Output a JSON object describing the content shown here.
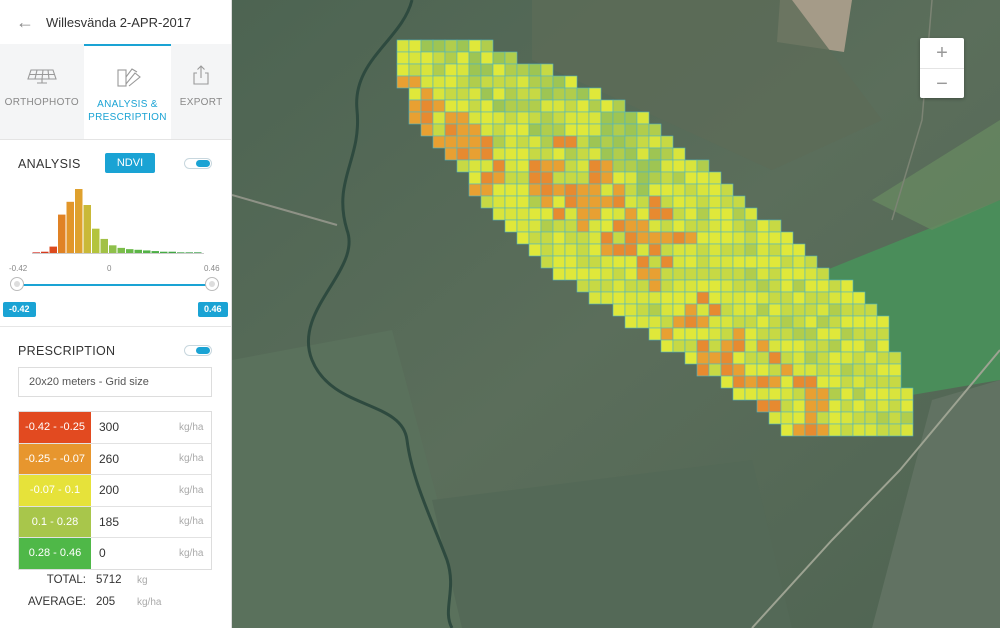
{
  "header": {
    "back_icon": "arrow-left-icon",
    "title": "Willesvända 2-APR-2017"
  },
  "tabs": [
    {
      "label": "ORTHOPHOTO",
      "icon": "solar-panel-icon",
      "active": false
    },
    {
      "label": "ANALYSIS &\nPRESCRIPTION",
      "icon": "color-swatch-icon",
      "active": true
    },
    {
      "label": "EXPORT",
      "icon": "export-icon",
      "active": false
    }
  ],
  "analysis": {
    "title": "ANALYSIS",
    "index_button": "NDVI",
    "toggle_on": true,
    "histogram": {
      "ticks": [
        "-0.42",
        "0",
        "0.46"
      ],
      "bins": [
        1,
        2,
        10,
        60,
        80,
        100,
        75,
        38,
        22,
        12,
        8,
        6,
        5,
        4,
        3,
        2,
        2,
        1,
        1,
        1
      ],
      "bin_colors": [
        "#d4281e",
        "#d63a1e",
        "#dc4a1e",
        "#e08225",
        "#e2962a",
        "#dfa12e",
        "#c9b938",
        "#b4c43d",
        "#a2c146",
        "#8fc04b",
        "#7bbd4a",
        "#68b948",
        "#5cb547",
        "#52b246",
        "#4caf45",
        "#46ab45",
        "#40a644",
        "#3ba243",
        "#369e42",
        "#319a41"
      ]
    },
    "slider": {
      "min": "-0.42",
      "max": "0.46"
    }
  },
  "prescription": {
    "title": "PRESCRIPTION",
    "toggle_on": true,
    "grid_size": "20x20 meters - Grid size",
    "unit": "kg/ha",
    "rows": [
      {
        "range": "-0.42 - -0.25",
        "rate": "300",
        "color": "#e24a20"
      },
      {
        "range": "-0.25 - -0.07",
        "rate": "260",
        "color": "#e7962e"
      },
      {
        "range": "-0.07 - 0.1",
        "rate": "200",
        "color": "#e6e23a"
      },
      {
        "range": "0.1 - 0.28",
        "rate": "185",
        "color": "#a8c64b"
      },
      {
        "range": "0.28 - 0.46",
        "rate": "0",
        "color": "#4fb848"
      }
    ],
    "total_label": "TOTAL:",
    "total_value": "5712",
    "total_unit": "kg",
    "average_label": "AVERAGE:",
    "average_value": "205",
    "average_unit": "kg/ha"
  },
  "map": {
    "zoom_in": "+",
    "zoom_out": "−",
    "palette": [
      "#e0e83a",
      "#d9e43c",
      "#c7d944",
      "#b1cd4c",
      "#9ec553",
      "#e8a032",
      "#e78a30",
      "#3dbf4a"
    ]
  }
}
